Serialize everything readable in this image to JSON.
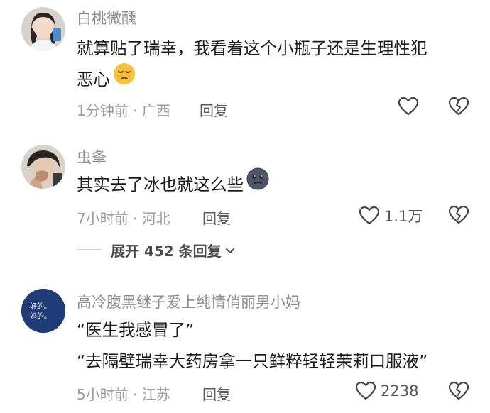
{
  "comments": [
    {
      "username": "白桃微醺",
      "text_lines": [
        "就算贴了瑞幸，我看着这个小瓶子还是生理性犯",
        "恶心"
      ],
      "emoji": "pensive-face",
      "time_location": "1分钟前 · 广西",
      "reply_label": "回复",
      "like_count": ""
    },
    {
      "username": "虫夆",
      "text_lines": [
        "其实去了冰也就这么些"
      ],
      "emoji": "gray-face",
      "time_location": "7小时前 · 河北",
      "reply_label": "回复",
      "like_count": "1.1万"
    },
    {
      "username": "高冷腹黑继子爱上纯情俏丽男小妈",
      "avatar_text": [
        "好的。",
        "妈的。"
      ],
      "text_lines": [
        "“医生我感冒了”",
        "“去隔壁瑞幸大药房拿一只鲜粹轻轻茉莉口服液”"
      ],
      "time_location": "5小时前 · 江苏",
      "reply_label": "回复",
      "like_count": "2238"
    }
  ],
  "expand_replies": {
    "label": "展开 452 条回复",
    "icon": "chevron-down-icon"
  },
  "colors": {
    "username": "#8c8c8c",
    "meta": "#9a9a9a",
    "avatar3_bg": "#1f3c78"
  }
}
